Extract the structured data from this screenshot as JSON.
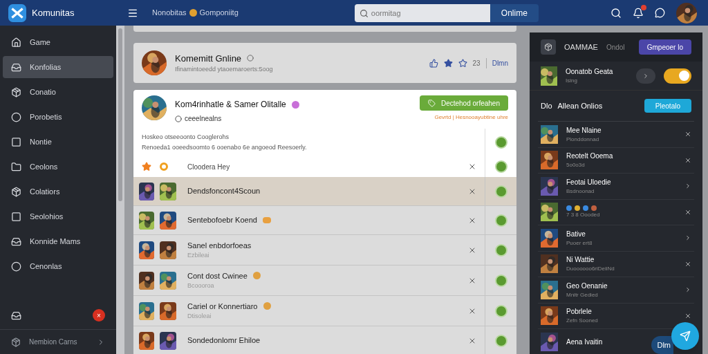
{
  "topbar": {
    "logo": "Komunitas",
    "breadcrumb": [
      "Nonobitas",
      "Gomponiitg"
    ],
    "search": {
      "placeholder": "oormitag"
    },
    "search_button": "Onlime",
    "notification": true
  },
  "sidebar": {
    "items": [
      {
        "label": "Game",
        "selected": false
      },
      {
        "label": "Konfolias",
        "selected": true
      },
      {
        "label": "Conatio",
        "selected": false
      },
      {
        "label": "Porobetis",
        "selected": false
      },
      {
        "label": "Nontie",
        "selected": false
      },
      {
        "label": "Ceolons",
        "selected": false
      },
      {
        "label": "Colatiors",
        "selected": false
      },
      {
        "label": "Seolohios",
        "selected": false
      },
      {
        "label": "Konnide Mams",
        "selected": false
      },
      {
        "label": "Cenonlas",
        "selected": false
      }
    ],
    "badge": "×",
    "footer": "Nembion Carns"
  },
  "card": {
    "title": "Komemitt Gnline",
    "subtitle": "Ifinamintoeedd ytaoemaroerts:5oog",
    "count": "23",
    "link": "Dlmn"
  },
  "post": {
    "title": "Kom4rinhatle & Samer Olitalle",
    "handle": "ceeelnealns",
    "button": "Dectehod orfeahen",
    "note": "Gevrtd | Hesnooayubtine uhre",
    "lines": [
      "Hoskeo otseeoonto Cooglerohs",
      "Renoeda1 ooeedsoomto 6 ooenabo 6e angoeod Reesoerly."
    ],
    "action": "Cloodera Hey"
  },
  "rows": [
    {
      "title": "Dendsfoncont4Scoun",
      "selected": true,
      "kind": "plain"
    },
    {
      "title": "Sentebofoebr Koend",
      "selected": false,
      "kind": "tagged"
    },
    {
      "title": "Sanel enbdorfoeas",
      "subtitle": "Ezbileai",
      "selected": false,
      "kind": "plain"
    },
    {
      "title": "Cont dost Cwinee",
      "subtitle": "Bcoooroa",
      "selected": false,
      "kind": "verified"
    },
    {
      "title": "Cariel or Konnertiaro",
      "subtitle": "Dtisoleai",
      "selected": false,
      "kind": "verified"
    },
    {
      "title": "Sondedonlomr Ehiloe",
      "selected": false,
      "kind": "plain"
    }
  ],
  "panel": {
    "title": "OAMMAE",
    "subtitle": "Ondol",
    "button": "Gmpeoer lo",
    "user": {
      "name": "Oonatob Geata",
      "sub": "Ising",
      "toggle_on": true
    },
    "section": {
      "prefix": "Dlo",
      "title": "Allean Onlios",
      "button": "Pleotalo"
    },
    "items": [
      {
        "name": "Mee Nlaine",
        "sub": "Plonddonnad",
        "kind": "close"
      },
      {
        "name": "Reotelt Ooema",
        "sub": "5o0o3d",
        "kind": "close"
      },
      {
        "name": "Feotai Uloedie",
        "sub": "Bsdnoonad",
        "kind": "open"
      },
      {
        "sub": "7 3 8 Oooded",
        "kind": "close"
      },
      {
        "name": "Bative",
        "sub": "Puoer ert8",
        "kind": "open"
      },
      {
        "name": "Ni Wattie",
        "sub": "Duoooooo6riDeiiNd",
        "kind": "close"
      },
      {
        "name": "Geo Oenanie",
        "sub": "Mnitr Gedied",
        "kind": "open"
      },
      {
        "name": "Pobrlele",
        "sub": "Zefn Sooned",
        "kind": "close"
      },
      {
        "name": "Aena Ivaitin",
        "kind": "plain"
      }
    ],
    "bottom_button": "Dlm"
  }
}
